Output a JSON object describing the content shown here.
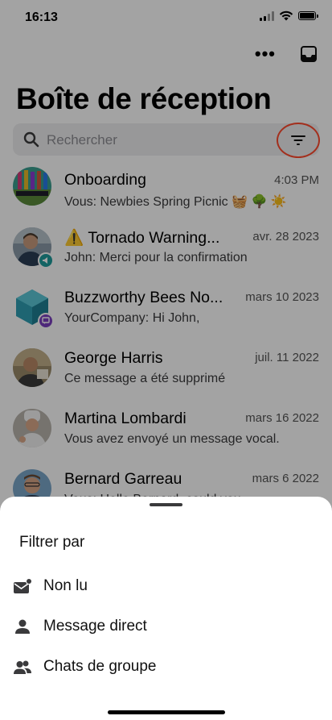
{
  "status_bar": {
    "time": "16:13"
  },
  "header": {
    "title": "Boîte de réception"
  },
  "search": {
    "placeholder": "Rechercher"
  },
  "conversations": [
    {
      "name": "Onboarding",
      "date": "4:03 PM",
      "preview": "Vous: Newbies Spring Picnic 🧺 🌳 ☀️"
    },
    {
      "name": "⚠️ Tornado Warning...",
      "date": "avr. 28 2023",
      "preview": "John: Merci pour la confirmation"
    },
    {
      "name": "Buzzworthy Bees No...",
      "date": "mars 10 2023",
      "preview": "YourCompany: Hi John,"
    },
    {
      "name": "George Harris",
      "date": "juil. 11 2022",
      "preview": "Ce message a été supprimé"
    },
    {
      "name": "Martina Lombardi",
      "date": "mars 16 2022",
      "preview": "Vous avez envoyé un message vocal."
    },
    {
      "name": "Bernard Garreau",
      "date": "mars 6 2022",
      "preview": "Vous: Hello Bernard, could you..."
    }
  ],
  "filter_sheet": {
    "title": "Filtrer par",
    "options": [
      {
        "label": "Non lu",
        "icon": "unread-mail-icon"
      },
      {
        "label": "Message direct",
        "icon": "person-icon"
      },
      {
        "label": "Chats de groupe",
        "icon": "group-icon"
      }
    ]
  },
  "colors": {
    "filter_highlight": "#ff4a2e",
    "badge_teal": "#1e9b9b",
    "badge_purple": "#7b3fbf",
    "overlay": "rgba(0,0,0,0.36)"
  }
}
